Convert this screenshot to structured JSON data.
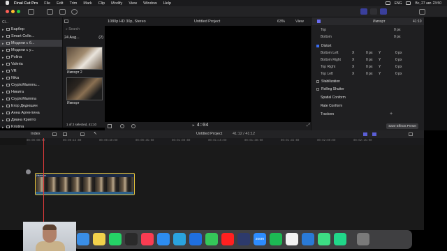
{
  "menubar": {
    "app": "Final Cut Pro",
    "items": [
      "File",
      "Edit",
      "Trim",
      "Mark",
      "Clip",
      "Modify",
      "View",
      "Window",
      "Help"
    ],
    "lang": "ENG",
    "datetime": "Вс, 27 авг. 23:50"
  },
  "library": {
    "header": "Cl...",
    "items": [
      {
        "label": "Барбер",
        "selected": false
      },
      {
        "label": "Smart Colle...",
        "selected": false
      },
      {
        "label": "Модели с б...",
        "selected": true
      },
      {
        "label": "Модели с у...",
        "selected": false
      },
      {
        "label": "Polina",
        "selected": false
      },
      {
        "label": "Valeria",
        "selected": false
      },
      {
        "label": "VR",
        "selected": false
      },
      {
        "label": "Nika",
        "selected": false
      },
      {
        "label": "CryptoMammu...",
        "selected": false
      },
      {
        "label": "Никита",
        "selected": false
      },
      {
        "label": "CryptoMamma",
        "selected": false
      },
      {
        "label": "Егор Дедюшин",
        "selected": false
      },
      {
        "label": "Анна Аргентина",
        "selected": false
      },
      {
        "label": "Диана Криптo",
        "selected": false
      },
      {
        "label": "Kristina",
        "selected": false
      }
    ]
  },
  "browser": {
    "search_placeholder": "Search",
    "group_title": "24 Aug...",
    "group_count": "(2)",
    "clips": [
      "Импорт 2",
      "Импорт"
    ],
    "selection_status": "1 of 2 selected, 41:10"
  },
  "viewer": {
    "format": "1080p HD 30p, Stereo",
    "title": "Untitled Project",
    "zoom": "63%",
    "view_label": "View",
    "timecode": "4:04"
  },
  "inspector": {
    "clip_name": "Импорт",
    "duration": "41:10",
    "rows": [
      {
        "label": "Top",
        "value": "0 px"
      },
      {
        "label": "Bottom",
        "value": "0 px"
      }
    ],
    "distort": {
      "label": "Distort",
      "corners": [
        {
          "label": "Bottom Left",
          "x": "0 px",
          "y": "0 px"
        },
        {
          "label": "Bottom Right",
          "x": "0 px",
          "y": "0 px"
        },
        {
          "label": "Top Right",
          "x": "0 px",
          "y": "0 px"
        },
        {
          "label": "Top Left",
          "x": "0 px",
          "y": "0 px"
        }
      ]
    },
    "sections": [
      "Stabilization",
      "Rolling Shutter",
      "Spatial Conform",
      "Rate Conform",
      "Trackers"
    ],
    "save_button": "Save Effects Preset"
  },
  "timeline": {
    "index_label": "Index",
    "project_title": "Untitled Project",
    "duration": "41:12 / 41:12",
    "ruler": [
      "00:00:00:00",
      "00:00:15:00",
      "00:00:30:00",
      "00:00:45:00",
      "00:01:00:00",
      "00:01:15:00",
      "00:01:30:00",
      "00:01:45:00",
      "00:02:00:00",
      "00:02:15:00"
    ],
    "clip_label": "Импорт"
  },
  "dock": {
    "apps": [
      "finder-icon",
      "notes-icon",
      "whatsapp-icon",
      "claquette-icon",
      "music-icon",
      "safari-icon",
      "telegram-icon",
      "copilot-icon",
      "facetime-icon",
      "youtube-icon",
      "vpn-icon",
      "zoom-icon",
      "spotify-icon",
      "notion-icon",
      "vscode-icon",
      "android-icon",
      "pycharm-icon",
      "trash-icon"
    ],
    "zoom_label": "zoom"
  },
  "colors": {
    "accent": "#3a3f9c",
    "clip_border": "#e6c23a",
    "playhead": "#e23b3b"
  }
}
